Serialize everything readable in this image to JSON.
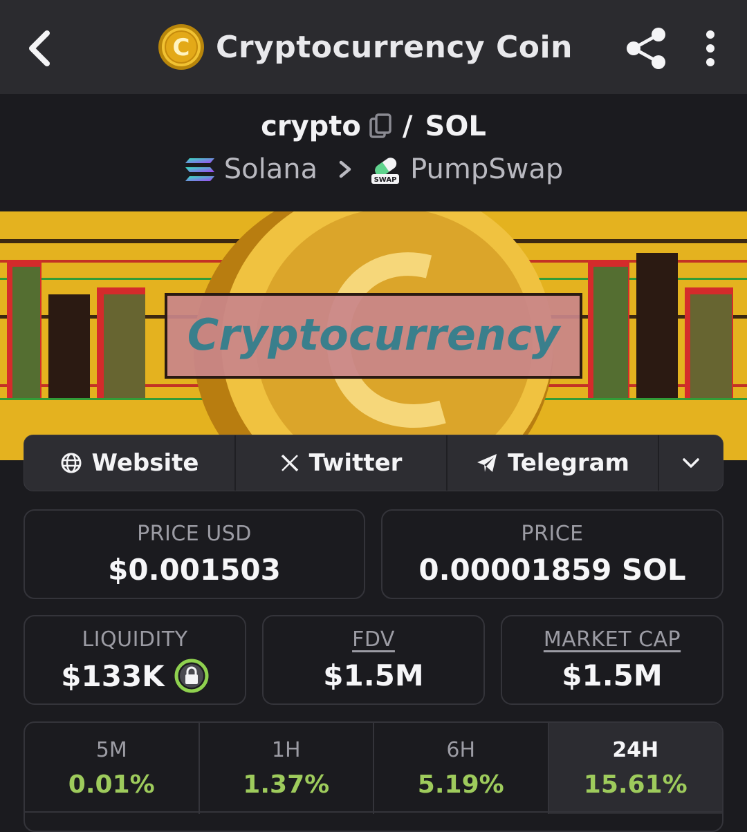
{
  "header": {
    "title": "Cryptocurrency Coin",
    "coin_symbol_glyph": "C"
  },
  "pair": {
    "base": "crypto",
    "separator": "/",
    "quote": "SOL",
    "chain": "Solana",
    "dex": "PumpSwap",
    "dex_badge": "SWAP"
  },
  "banner": {
    "text": "Cryptocurrency"
  },
  "links": {
    "website": "Website",
    "twitter": "Twitter",
    "telegram": "Telegram"
  },
  "stats": {
    "price_usd_label": "PRICE USD",
    "price_usd": "$0.001503",
    "price_label": "PRICE",
    "price": "0.00001859 SOL",
    "liquidity_label": "LIQUIDITY",
    "liquidity": "$133K",
    "fdv_label": "FDV",
    "fdv": "$1.5M",
    "mcap_label": "MARKET CAP",
    "mcap": "$1.5M"
  },
  "timeframes": [
    {
      "label": "5M",
      "change": "0.01%"
    },
    {
      "label": "1H",
      "change": "1.37%"
    },
    {
      "label": "6H",
      "change": "5.19%"
    },
    {
      "label": "24H",
      "change": "15.61%"
    }
  ],
  "colors": {
    "accent_green": "#9ecb5c",
    "banner_yellow": "#e9b824",
    "lock_green": "#8fd14f"
  },
  "icons": [
    "back-icon",
    "coin-logo-icon",
    "share-icon",
    "more-icon",
    "copy-icon",
    "solana-icon",
    "chevron-right-icon",
    "pumpswap-icon",
    "globe-icon",
    "x-icon",
    "telegram-icon",
    "chevron-down-icon",
    "lock-icon"
  ]
}
